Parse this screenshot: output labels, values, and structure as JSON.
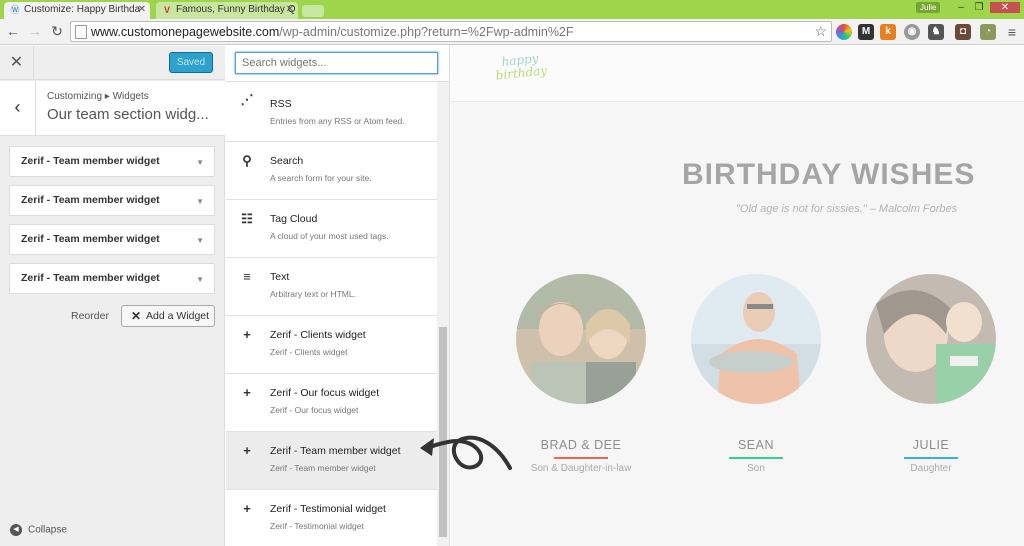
{
  "browser": {
    "tabs": [
      {
        "title": "Customize: Happy Birthda",
        "active": true
      },
      {
        "title": "Famous, Funny Birthday Q",
        "active": false
      }
    ],
    "profile": "Julie",
    "url_host": "www.customonepagewebsite.com",
    "url_path": "/wp-admin/customize.php?return=%2Fwp-admin%2F",
    "extensions": [
      "multicolor-icon",
      "m-icon",
      "k-icon",
      "eye-icon",
      "puzzle-icon",
      "instagram-icon",
      "owl-icon",
      "menu-icon"
    ]
  },
  "sidebar": {
    "saved_label": "Saved",
    "breadcrumb": "Customizing ▸ Widgets",
    "panel_title": "Our team section widg...",
    "widgets": [
      "Zerif - Team member widget",
      "Zerif - Team member widget",
      "Zerif - Team member widget",
      "Zerif - Team member widget"
    ],
    "reorder_label": "Reorder",
    "add_widget_label": "Add a Widget",
    "collapse_label": "Collapse"
  },
  "available": {
    "search_placeholder": "Search widgets...",
    "items": [
      {
        "icon": "rss-icon",
        "name": "RSS",
        "desc": "Entries from any RSS or Atom feed."
      },
      {
        "icon": "search-icon",
        "name": "Search",
        "desc": "A search form for your site."
      },
      {
        "icon": "tag-cloud-icon",
        "name": "Tag Cloud",
        "desc": "A cloud of your most used tags."
      },
      {
        "icon": "text-icon",
        "name": "Text",
        "desc": "Arbitrary text or HTML."
      },
      {
        "icon": "plus-icon",
        "name": "Zerif - Clients widget",
        "desc": "Zerif - Clients widget"
      },
      {
        "icon": "plus-icon",
        "name": "Zerif - Our focus widget",
        "desc": "Zerif - Our focus widget"
      },
      {
        "icon": "plus-icon",
        "name": "Zerif - Team member widget",
        "desc": "Zerif - Team member widget",
        "highlighted": true
      },
      {
        "icon": "plus-icon",
        "name": "Zerif - Testimonial widget",
        "desc": "Zerif - Testimonial widget"
      }
    ]
  },
  "preview": {
    "logo_line1": "happy",
    "logo_line2": "birthday",
    "title": "BIRTHDAY WISHES",
    "quote": "\"Old age is not for sissies.\" – Malcolm Forbes",
    "members": [
      {
        "name": "BRAD & DEE",
        "role": "Son & Daughter-in-law",
        "accent": "#e96656"
      },
      {
        "name": "SEAN",
        "role": "Son",
        "accent": "#34d293"
      },
      {
        "name": "JULIE",
        "role": "Daughter",
        "accent": "#3ab0e2"
      }
    ]
  },
  "colors": {
    "tab_strip": "#9ed54a",
    "saved_button": "#2ea2cc",
    "focus_border": "#5b9dd9"
  }
}
